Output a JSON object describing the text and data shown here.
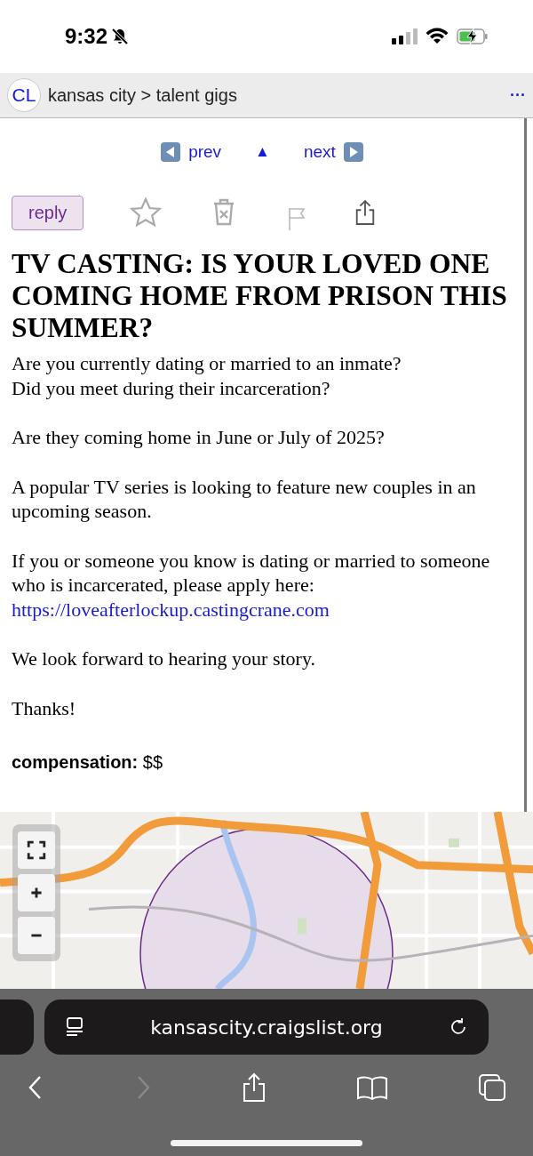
{
  "status_bar": {
    "time": "9:32"
  },
  "header": {
    "logo": "CL",
    "breadcrumb": "kansas city > talent gigs",
    "menu": "···"
  },
  "nav": {
    "prev": "prev",
    "up": "▲",
    "next": "next"
  },
  "actions": {
    "reply": "reply"
  },
  "post": {
    "title": "TV CASTING: IS YOUR LOVED ONE COMING HOME FROM PRISON THIS SUMMER?",
    "paragraphs": [
      {
        "lines": [
          "Are you currently dating or married to an inmate?",
          "Did you meet during their incarceration?"
        ]
      },
      {
        "lines": [
          "Are they coming home in June or July of 2025?"
        ]
      },
      {
        "lines": [
          "A popular TV series is looking to feature new couples in an upcoming season."
        ]
      },
      {
        "lines": [
          "If you or someone you know is dating or married to someone who is incarcerated, please apply here:"
        ],
        "link": "https://loveafterlockup.castingcrane.com"
      },
      {
        "lines": [
          "We look forward to hearing your story."
        ]
      },
      {
        "lines": [
          "Thanks!"
        ]
      }
    ],
    "compensation_label": "compensation:",
    "compensation_value": "$$"
  },
  "browser": {
    "url": "kansascity.craigslist.org",
    "forward_disabled": true
  }
}
